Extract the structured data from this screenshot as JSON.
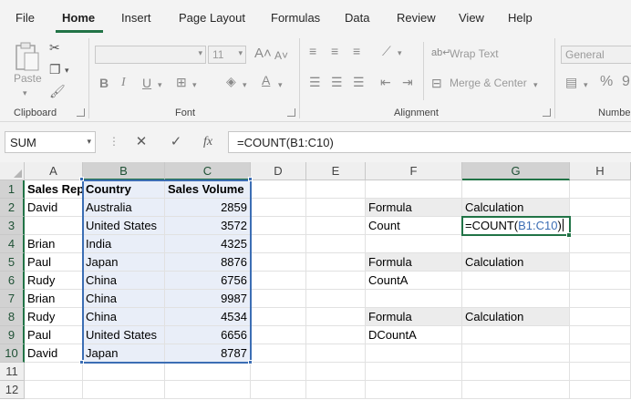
{
  "menu": {
    "tabs": [
      "File",
      "Home",
      "Insert",
      "Page Layout",
      "Formulas",
      "Data",
      "Review",
      "View",
      "Help"
    ],
    "active": "Home"
  },
  "ribbon": {
    "clipboard": {
      "label": "Clipboard",
      "paste_label": "Paste"
    },
    "font": {
      "label": "Font",
      "size": "11",
      "bold": "B",
      "italic": "I",
      "underline": "U"
    },
    "alignment": {
      "label": "Alignment",
      "wrap_text": "Wrap Text",
      "merge_center": "Merge & Center"
    },
    "number": {
      "label": "Number",
      "format": "General",
      "percent": "%"
    }
  },
  "formula_bar": {
    "name_box": "SUM",
    "cancel_icon": "close-icon",
    "enter_icon": "check-icon",
    "fx_label": "fx",
    "formula": "=COUNT(B1:C10)"
  },
  "grid": {
    "columns": [
      "A",
      "B",
      "C",
      "D",
      "E",
      "F",
      "G",
      "H"
    ],
    "rows": [
      "1",
      "2",
      "3",
      "4",
      "5",
      "6",
      "7",
      "8",
      "9",
      "10",
      "11",
      "12"
    ],
    "data_headers": {
      "a1": "Sales Rep",
      "b1": "Country",
      "c1": "Sales Volume"
    },
    "records": [
      {
        "rep": "David",
        "country": "Australia",
        "volume": "2859"
      },
      {
        "rep": "",
        "country": "United States",
        "volume": "3572"
      },
      {
        "rep": "Brian",
        "country": "India",
        "volume": "4325"
      },
      {
        "rep": "Paul",
        "country": "Japan",
        "volume": "8876"
      },
      {
        "rep": "Rudy",
        "country": "China",
        "volume": "6756"
      },
      {
        "rep": "Brian",
        "country": "China",
        "volume": "9987"
      },
      {
        "rep": "Rudy",
        "country": "China",
        "volume": "4534"
      },
      {
        "rep": "Paul",
        "country": "United States",
        "volume": "6656"
      },
      {
        "rep": "David",
        "country": "Japan",
        "volume": "8787"
      }
    ],
    "side": {
      "f2": "Formula",
      "g2": "Calculation",
      "f3": "Count",
      "f5": "Formula",
      "g5": "Calculation",
      "f6": "CountA",
      "f8": "Formula",
      "g8": "Calculation",
      "f9": "DCountA"
    },
    "editing": {
      "prefix": "=COUNT(",
      "ref": "B1:C10",
      "suffix": ")"
    }
  },
  "colors": {
    "accent": "#217346",
    "range_highlight": "#3c6eb4"
  }
}
